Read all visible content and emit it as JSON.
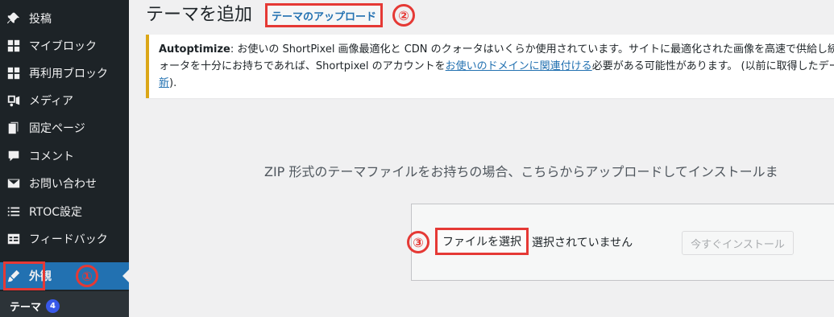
{
  "sidebar": {
    "items": [
      {
        "label": "投稿",
        "icon": "pin-icon"
      },
      {
        "label": "マイブロック",
        "icon": "blocks-icon"
      },
      {
        "label": "再利用ブロック",
        "icon": "blocks-icon"
      },
      {
        "label": "メディア",
        "icon": "media-icon"
      },
      {
        "label": "固定ページ",
        "icon": "pages-icon"
      },
      {
        "label": "コメント",
        "icon": "comment-icon"
      },
      {
        "label": "お問い合わせ",
        "icon": "mail-icon"
      },
      {
        "label": "RTOC設定",
        "icon": "list-icon"
      },
      {
        "label": "フィードバック",
        "icon": "feedback-icon"
      },
      {
        "label": "外観",
        "icon": "brush-icon",
        "active": true
      }
    ],
    "submenu": {
      "label": "テーマ",
      "badge": "4"
    }
  },
  "annotations": {
    "n1": "①",
    "n2": "②",
    "n3": "③",
    "color": "#e53935"
  },
  "main": {
    "title": "テーマを追加",
    "upload_button": "テーマのアップロード",
    "notice": {
      "plugin": "Autoptimize",
      "text1": ": お使いの ShortPixel 画像最適化と CDN のクォータはいくらか使用されています。サイトに最適化された画像を高速で供給し続け",
      "text2a": "ォータを十分にお持ちであれば、Shortpixel のアカウントを",
      "link": "お使いのドメインに関連付ける",
      "text2b": "必要がある可能性があります。 (以前に取得したデー",
      "link2": "新",
      "text3": ")."
    },
    "instructions": "ZIP 形式のテーマファイルをお持ちの場合、こちらからアップロードしてインストールま",
    "file_button": "ファイルを選択",
    "no_file": "選択されていません",
    "install_button": "今すぐインストール"
  },
  "colors": {
    "sidebar_bg": "#1d2327",
    "accent": "#2271b1",
    "notice_border": "#dba617"
  }
}
